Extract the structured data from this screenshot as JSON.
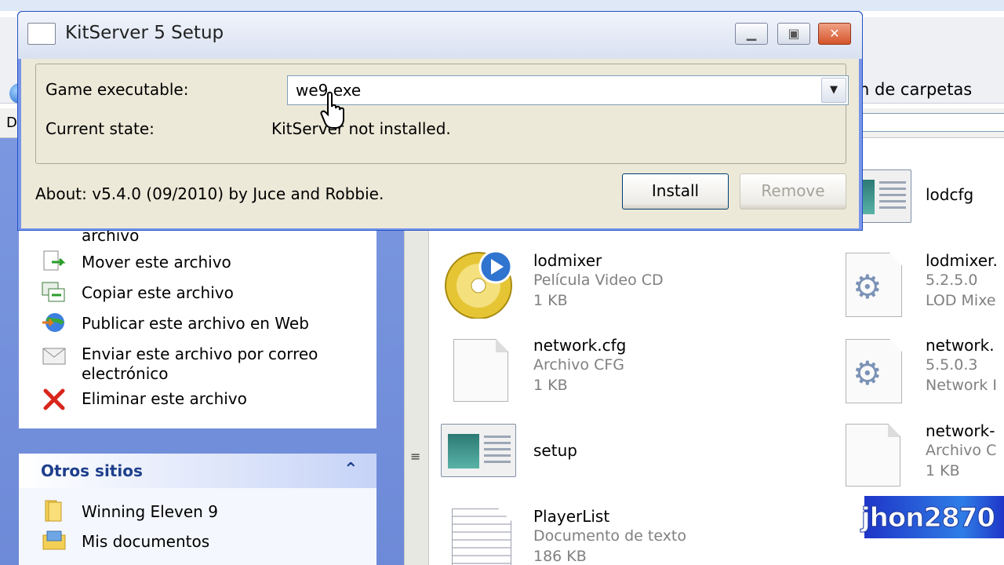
{
  "dialog": {
    "title": "KitServer 5 Setup",
    "game_executable_label": "Game executable:",
    "game_executable_value": "we9.exe",
    "current_state_label": "Current state:",
    "current_state_value": "KitServer not installed.",
    "about": "About: v5.4.0 (09/2010) by Juce and Robbie.",
    "install_label": "Install",
    "remove_label": "Remove",
    "window_buttons": [
      "minimize-icon",
      "maximize-icon",
      "close-icon"
    ]
  },
  "explorer": {
    "toolbar_folders": "n de carpetas",
    "address_label": "D"
  },
  "tasks": {
    "truncated": "archivo",
    "items": [
      {
        "label": "Mover este archivo",
        "icon": "move-file-icon"
      },
      {
        "label": "Copiar este archivo",
        "icon": "copy-file-icon"
      },
      {
        "label": "Publicar este archivo en Web",
        "icon": "publish-web-icon"
      },
      {
        "label": "Enviar este archivo por correo",
        "label2": "electrónico",
        "icon": "email-icon"
      },
      {
        "label": "Eliminar este archivo",
        "icon": "delete-icon"
      }
    ]
  },
  "other_places": {
    "title": "Otros sitios",
    "items": [
      {
        "label": "Winning Eleven 9",
        "icon": "folder-icon"
      },
      {
        "label": "Mis documentos",
        "icon": "my-documents-icon"
      }
    ]
  },
  "files": [
    {
      "name": "lodcfg",
      "type": "",
      "size": ""
    },
    {
      "name": "lodmixer",
      "type": "Película Video CD",
      "size": "1 KB"
    },
    {
      "name": "lodmixer.",
      "type": "5.2.5.0",
      "size": "LOD Mixe"
    },
    {
      "name": "network.cfg",
      "type": "Archivo CFG",
      "size": "1 KB"
    },
    {
      "name": "network.",
      "type": "5.5.0.3",
      "size": "Network I"
    },
    {
      "name": "setup",
      "type": "",
      "size": ""
    },
    {
      "name": "network-",
      "type": "Archivo C",
      "size": "1 KB"
    },
    {
      "name": "PlayerList",
      "type": "Documento de texto",
      "size": "186 KB"
    }
  ],
  "watermark": "jhon2870"
}
